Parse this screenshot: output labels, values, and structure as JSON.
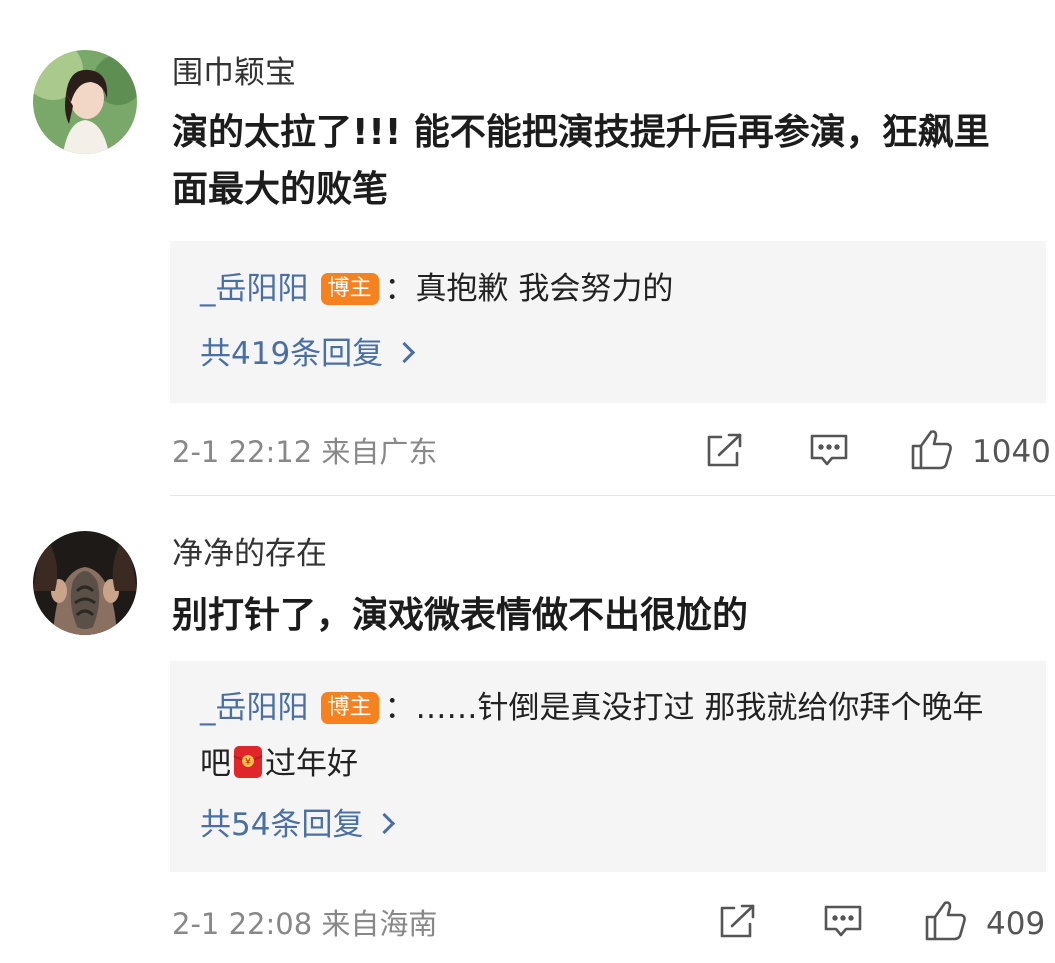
{
  "comments": [
    {
      "author": "围巾颖宝",
      "text": "演的太拉了!!! 能不能把演技提升后再参演，狂飙里面最大的败笔",
      "reply": {
        "author": "_岳阳阳",
        "badge": "博主",
        "text_before": "：真抱歉 我会努力的",
        "text_after": ""
      },
      "reply_count": "共419条回复",
      "meta": "2-1 22:12  来自广东",
      "likes": "1040"
    },
    {
      "author": "净净的存在",
      "text": "别打针了，演戏微表情做不出很尬的",
      "reply": {
        "author": "_岳阳阳",
        "badge": "博主",
        "text_before": "：……针倒是真没打过 那我就给你拜个晚年吧",
        "text_after": "过年好"
      },
      "reply_count": "共54条回复",
      "meta": "2-1 22:08  来自海南",
      "likes": "409"
    }
  ],
  "colors": {
    "link_blue": "#4a6fa5",
    "badge_orange": "#f5821f",
    "reply_bg": "#f5f5f5",
    "meta_gray": "#888888"
  },
  "icons": [
    "share-icon",
    "comment-icon",
    "like-icon",
    "chevron-right-icon",
    "red-envelope-emoji"
  ]
}
